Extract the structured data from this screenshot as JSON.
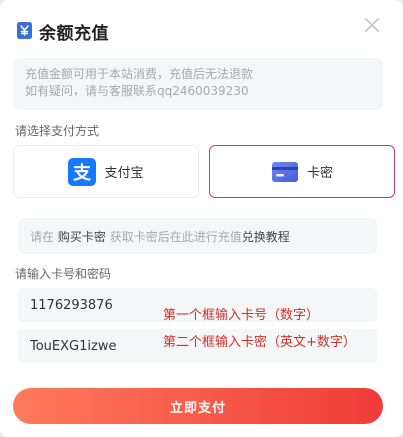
{
  "header": {
    "title": "余额充值",
    "title_icon": "wallet-icon",
    "close_icon": "close-icon"
  },
  "notice": {
    "line1": "充值金额可用于本站消费，充值后无法退款",
    "line2": "如有疑问，请与客服联系qq2460039230"
  },
  "payment": {
    "section_label": "请选择支付方式",
    "options": [
      {
        "label": "支付宝",
        "icon": "alipay-icon",
        "selected": false
      },
      {
        "label": "卡密",
        "icon": "card-icon",
        "selected": true
      }
    ],
    "selected_border_color": "#c33a8a"
  },
  "info": {
    "prefix": "请在",
    "buy_link": "购买卡密",
    "middle": "获取卡密后在此进行充值",
    "tutorial_link": "兑换教程"
  },
  "card_form": {
    "section_label": "请输入卡号和密码",
    "card_number_value": "1176293876",
    "card_password_value": "TouEXG1izwe",
    "annotation_card": "第一个框输入卡号（数字）",
    "annotation_password": "第二个框输入卡密（英文+数字）",
    "annotation_color": "#d0302a"
  },
  "submit": {
    "label": "立即支付",
    "gradient": [
      "#ff7a5c",
      "#ef3b38"
    ]
  }
}
